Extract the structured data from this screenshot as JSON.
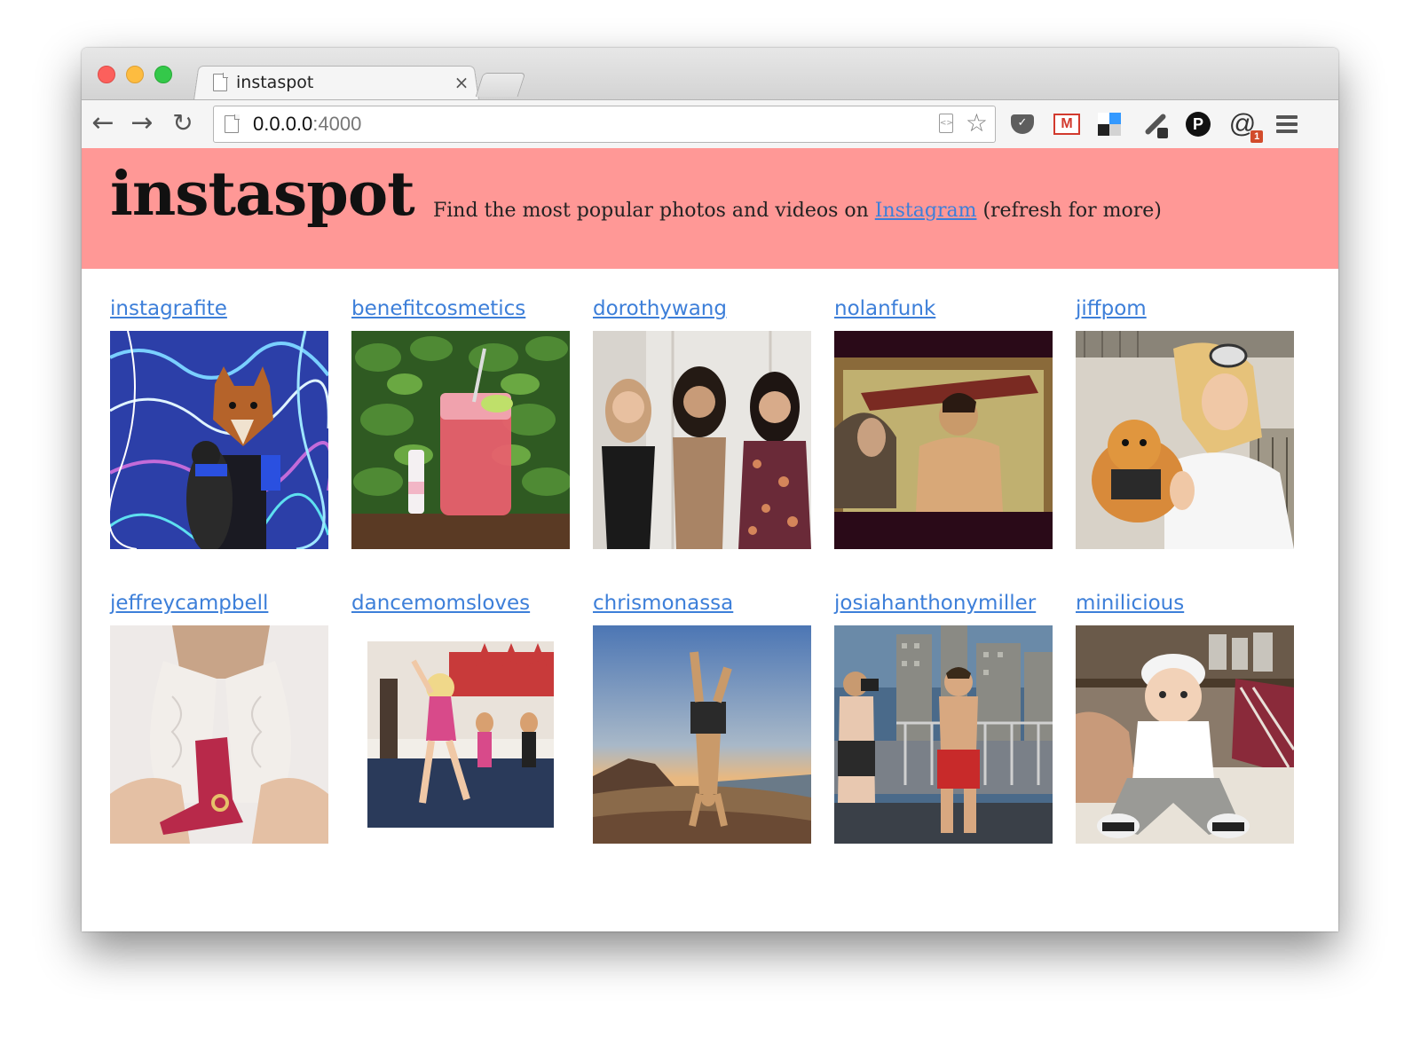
{
  "browser": {
    "tab_title": "instaspot",
    "tab_close": "×",
    "url_host": "0.0.0.0",
    "url_port": ":4000",
    "extension_badge": "1"
  },
  "header": {
    "title": "instaspot",
    "tagline_before": "Find the most popular photos and videos on ",
    "tagline_link": "Instagram",
    "tagline_after": " (refresh for more)"
  },
  "posts": [
    {
      "username": "instagrafite",
      "photo_icon": "fox-mask-couple-photo"
    },
    {
      "username": "benefitcosmetics",
      "photo_icon": "pink-drink-photo"
    },
    {
      "username": "dorothywang",
      "photo_icon": "three-women-photo"
    },
    {
      "username": "nolanfunk",
      "photo_icon": "shirtless-man-car-photo"
    },
    {
      "username": "jiffpom",
      "photo_icon": "woman-pomeranian-photo"
    },
    {
      "username": "jeffreycampbell",
      "photo_icon": "red-boots-photo"
    },
    {
      "username": "dancemomsloves",
      "photo_icon": "dance-studio-photo"
    },
    {
      "username": "chrismonassa",
      "photo_icon": "handstand-mountain-photo"
    },
    {
      "username": "josiahanthonymiller",
      "photo_icon": "rooftop-man-photo"
    },
    {
      "username": "minilicious",
      "photo_icon": "baby-photo"
    }
  ],
  "colors": {
    "header_bg": "#ff9896",
    "link": "#3d7fd9"
  }
}
